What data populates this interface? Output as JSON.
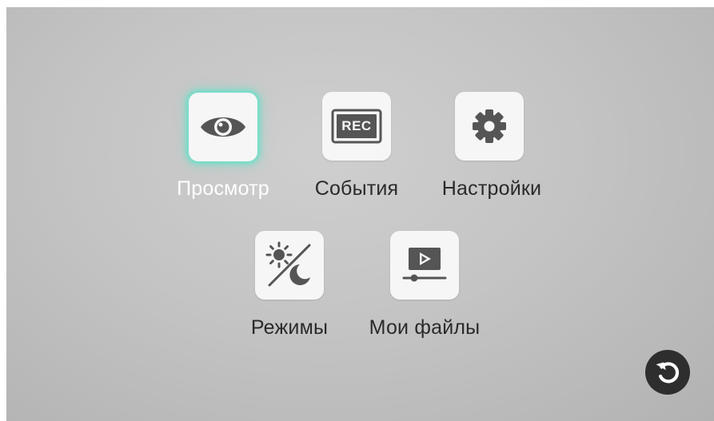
{
  "menu": {
    "items": [
      {
        "label": "Просмотр",
        "icon": "eye-icon",
        "selected": true
      },
      {
        "label": "События",
        "icon": "rec-icon",
        "icon_text": "REC",
        "selected": false
      },
      {
        "label": "Настройки",
        "icon": "gear-icon",
        "selected": false
      },
      {
        "label": "Режимы",
        "icon": "day-night-icon",
        "selected": false
      },
      {
        "label": "Мои файлы",
        "icon": "video-files-icon",
        "selected": false
      }
    ]
  },
  "back_button": {
    "icon": "back-arrow-icon"
  },
  "colors": {
    "selection_glow": "#60e2c8",
    "icon": "#555555",
    "tile": "#f6f6f6",
    "back_button": "#2e2e2e"
  }
}
